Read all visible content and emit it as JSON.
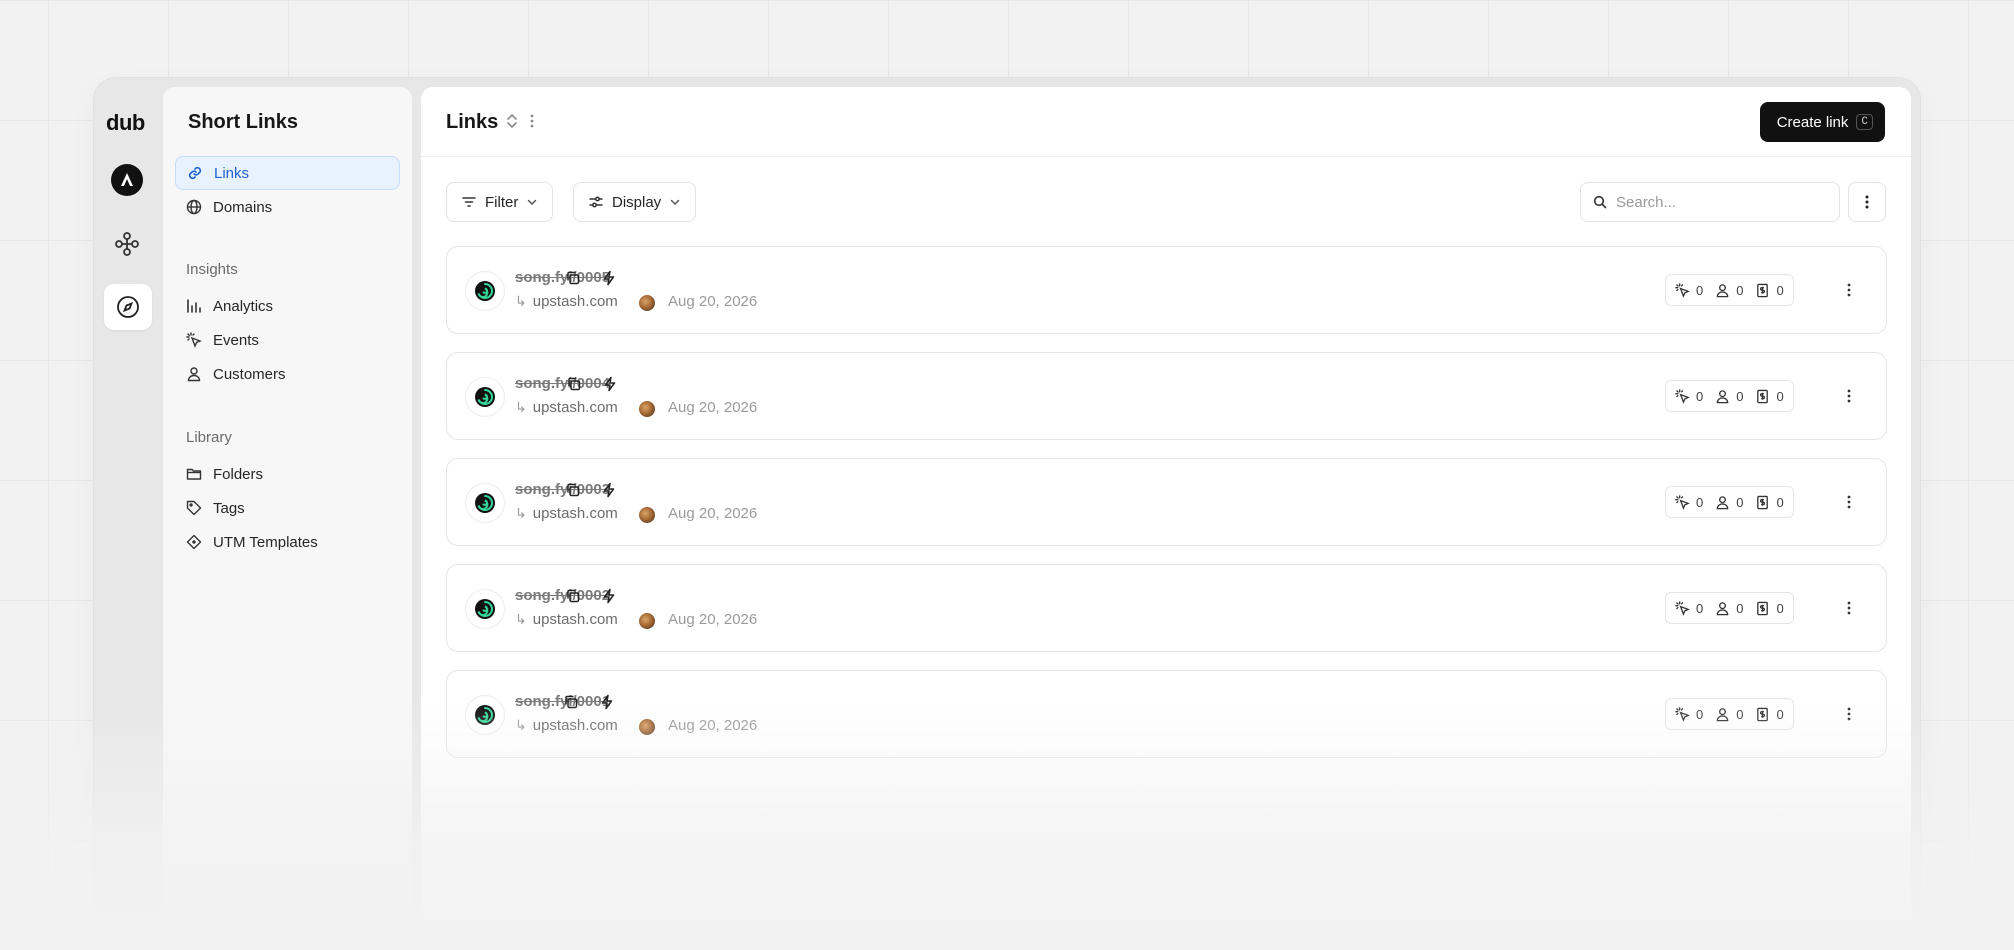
{
  "rail": {
    "logo": "dub",
    "workspace_icon": "workspace-avatar-icon",
    "program_icon": "network-icon",
    "active_icon": "compass-icon"
  },
  "sidebar": {
    "title": "Short Links",
    "primary": [
      {
        "label": "Links",
        "icon": "link-icon",
        "selected": true
      },
      {
        "label": "Domains",
        "icon": "globe-icon"
      }
    ],
    "insights_label": "Insights",
    "insights": [
      {
        "label": "Analytics",
        "icon": "bar-chart-icon"
      },
      {
        "label": "Events",
        "icon": "cursor-click-icon"
      },
      {
        "label": "Customers",
        "icon": "user-icon"
      }
    ],
    "library_label": "Library",
    "library": [
      {
        "label": "Folders",
        "icon": "folder-icon"
      },
      {
        "label": "Tags",
        "icon": "tag-icon"
      },
      {
        "label": "UTM Templates",
        "icon": "diamond-tag-icon"
      }
    ]
  },
  "header": {
    "title": "Links",
    "create_label": "Create link",
    "create_shortcut": "C"
  },
  "toolbar": {
    "filter_label": "Filter",
    "display_label": "Display",
    "search_placeholder": "Search..."
  },
  "links": [
    {
      "short": "song.fyi/0005",
      "destination": "upstash.com",
      "date": "Aug 20, 2026",
      "clicks": "0",
      "leads": "0",
      "sales": "0"
    },
    {
      "short": "song.fyi/0004",
      "destination": "upstash.com",
      "date": "Aug 20, 2026",
      "clicks": "0",
      "leads": "0",
      "sales": "0"
    },
    {
      "short": "song.fyi/0003",
      "destination": "upstash.com",
      "date": "Aug 20, 2026",
      "clicks": "0",
      "leads": "0",
      "sales": "0"
    },
    {
      "short": "song.fyi/0002",
      "destination": "upstash.com",
      "date": "Aug 20, 2026",
      "clicks": "0",
      "leads": "0",
      "sales": "0"
    },
    {
      "short": "song.fyi/0001",
      "destination": "upstash.com",
      "date": "Aug 20, 2026",
      "clicks": "0",
      "leads": "0",
      "sales": "0"
    }
  ],
  "colors": {
    "accent": "#1d62d1",
    "selected_bg": "#e8f1fe",
    "primary_button": "#111111"
  }
}
